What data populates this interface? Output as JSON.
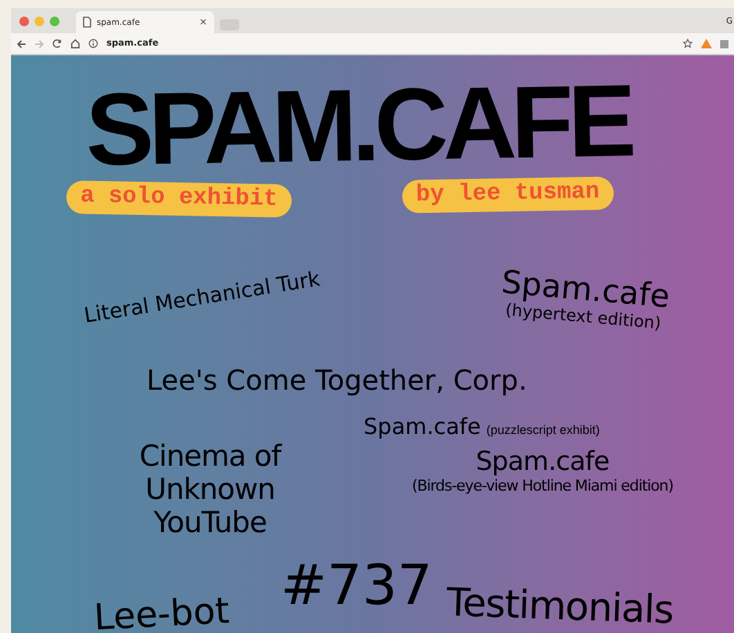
{
  "browser": {
    "tab": {
      "title": "spam.cafe",
      "close": "×",
      "selected": true
    },
    "address": "spam.cafe",
    "profile": "G"
  },
  "page": {
    "title": "SPAM.CAFE",
    "taglines": [
      "a solo exhibit",
      "by lee tusman"
    ],
    "links": [
      {
        "label": "Literal Mechanical Turk"
      },
      {
        "label": "Spam.cafe",
        "note": "(hypertext edition)"
      },
      {
        "label": "Lee's Come Together, Corp."
      },
      {
        "label": "Spam.cafe",
        "note": "(puzzlescript exhibit)"
      },
      {
        "label": "Cinema of Unknown YouTube"
      },
      {
        "label": "Spam.cafe",
        "note": "(Birds-eye-view Hotline Miami edition)"
      },
      {
        "label": "Lee-bot"
      },
      {
        "label": "#737"
      },
      {
        "label": "Testimonials"
      }
    ]
  }
}
